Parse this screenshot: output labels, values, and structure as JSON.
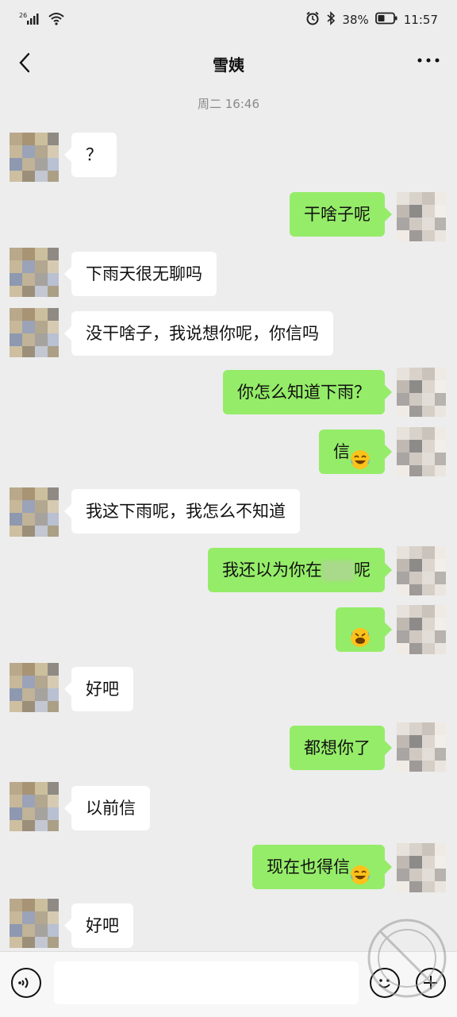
{
  "status_bar": {
    "network": "26",
    "battery_percent": "38%",
    "time": "11:57",
    "icons": [
      "signal-icon",
      "wifi-icon",
      "alarm-icon",
      "bluetooth-icon",
      "battery-icon"
    ]
  },
  "header": {
    "title": "雪姨",
    "back_icon": "back-arrow-icon",
    "more_icon": "more-icon"
  },
  "timestamp": "周二 16:46",
  "messages": [
    {
      "side": "left",
      "text": "？"
    },
    {
      "side": "right",
      "text": "干啥子呢"
    },
    {
      "side": "left",
      "text": "下雨天很无聊吗"
    },
    {
      "side": "left",
      "text": "没干啥子，我说想你呢，你信吗"
    },
    {
      "side": "right",
      "text": "你怎么知道下雨？"
    },
    {
      "side": "right",
      "text": "信",
      "emoji": "tears-of-joy"
    },
    {
      "side": "left",
      "text": "我这下雨呢，我怎么不知道"
    },
    {
      "side": "right",
      "text_before": "我还以为你在",
      "text_after": "呢",
      "redacted": true
    },
    {
      "side": "right",
      "emoji": "rolling-laugh"
    },
    {
      "side": "left",
      "text": "好吧"
    },
    {
      "side": "right",
      "text": "都想你了"
    },
    {
      "side": "left",
      "text": "以前信"
    },
    {
      "side": "right",
      "text": "现在也得信",
      "emoji": "tears-of-joy"
    },
    {
      "side": "left",
      "text": "好吧"
    }
  ],
  "input_bar": {
    "voice_icon": "voice-icon",
    "emoji_icon": "emoji-icon",
    "plus_icon": "plus-icon",
    "placeholder": ""
  },
  "colors": {
    "background": "#ededed",
    "incoming_bubble": "#ffffff",
    "outgoing_bubble": "#95ec69"
  }
}
